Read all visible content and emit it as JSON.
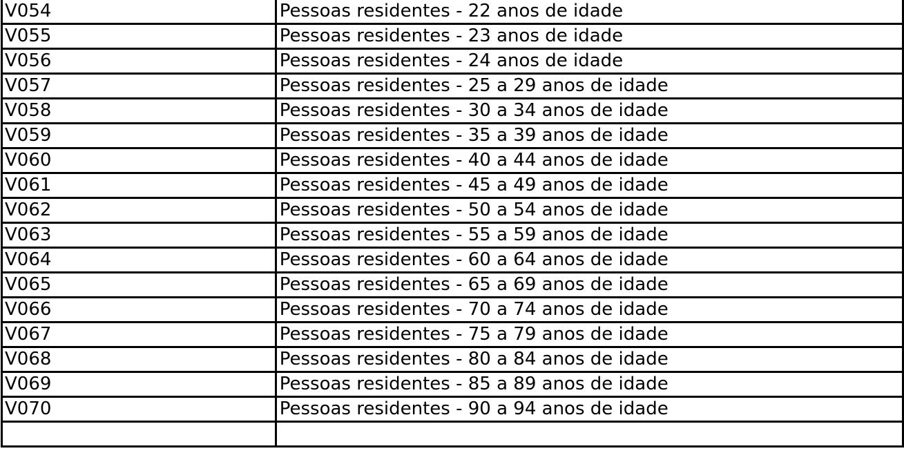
{
  "rows": [
    {
      "code": "V054",
      "description": "Pessoas residentes - 22 anos de idade"
    },
    {
      "code": "V055",
      "description": "Pessoas residentes - 23 anos de idade"
    },
    {
      "code": "V056",
      "description": "Pessoas residentes - 24 anos de idade"
    },
    {
      "code": "V057",
      "description": "Pessoas residentes - 25 a 29 anos de idade"
    },
    {
      "code": "V058",
      "description": "Pessoas residentes - 30 a 34 anos de idade"
    },
    {
      "code": "V059",
      "description": "Pessoas residentes - 35 a 39 anos de idade"
    },
    {
      "code": "V060",
      "description": "Pessoas residentes - 40 a 44 anos de idade"
    },
    {
      "code": "V061",
      "description": "Pessoas residentes - 45 a 49 anos de idade"
    },
    {
      "code": "V062",
      "description": "Pessoas residentes - 50 a 54 anos de idade"
    },
    {
      "code": "V063",
      "description": "Pessoas residentes - 55 a 59 anos de idade"
    },
    {
      "code": "V064",
      "description": "Pessoas residentes - 60 a 64 anos de idade"
    },
    {
      "code": "V065",
      "description": "Pessoas residentes - 65 a 69 anos de idade"
    },
    {
      "code": "V066",
      "description": "Pessoas residentes - 70 a 74 anos de idade"
    },
    {
      "code": "V067",
      "description": "Pessoas residentes - 75 a 79 anos de idade"
    },
    {
      "code": "V068",
      "description": "Pessoas residentes - 80 a 84 anos de idade"
    },
    {
      "code": "V069",
      "description": "Pessoas residentes - 85 a 89 anos de idade"
    },
    {
      "code": "V070",
      "description": "Pessoas residentes - 90 a 94 anos de idade"
    },
    {
      "code": "",
      "description": ""
    }
  ]
}
